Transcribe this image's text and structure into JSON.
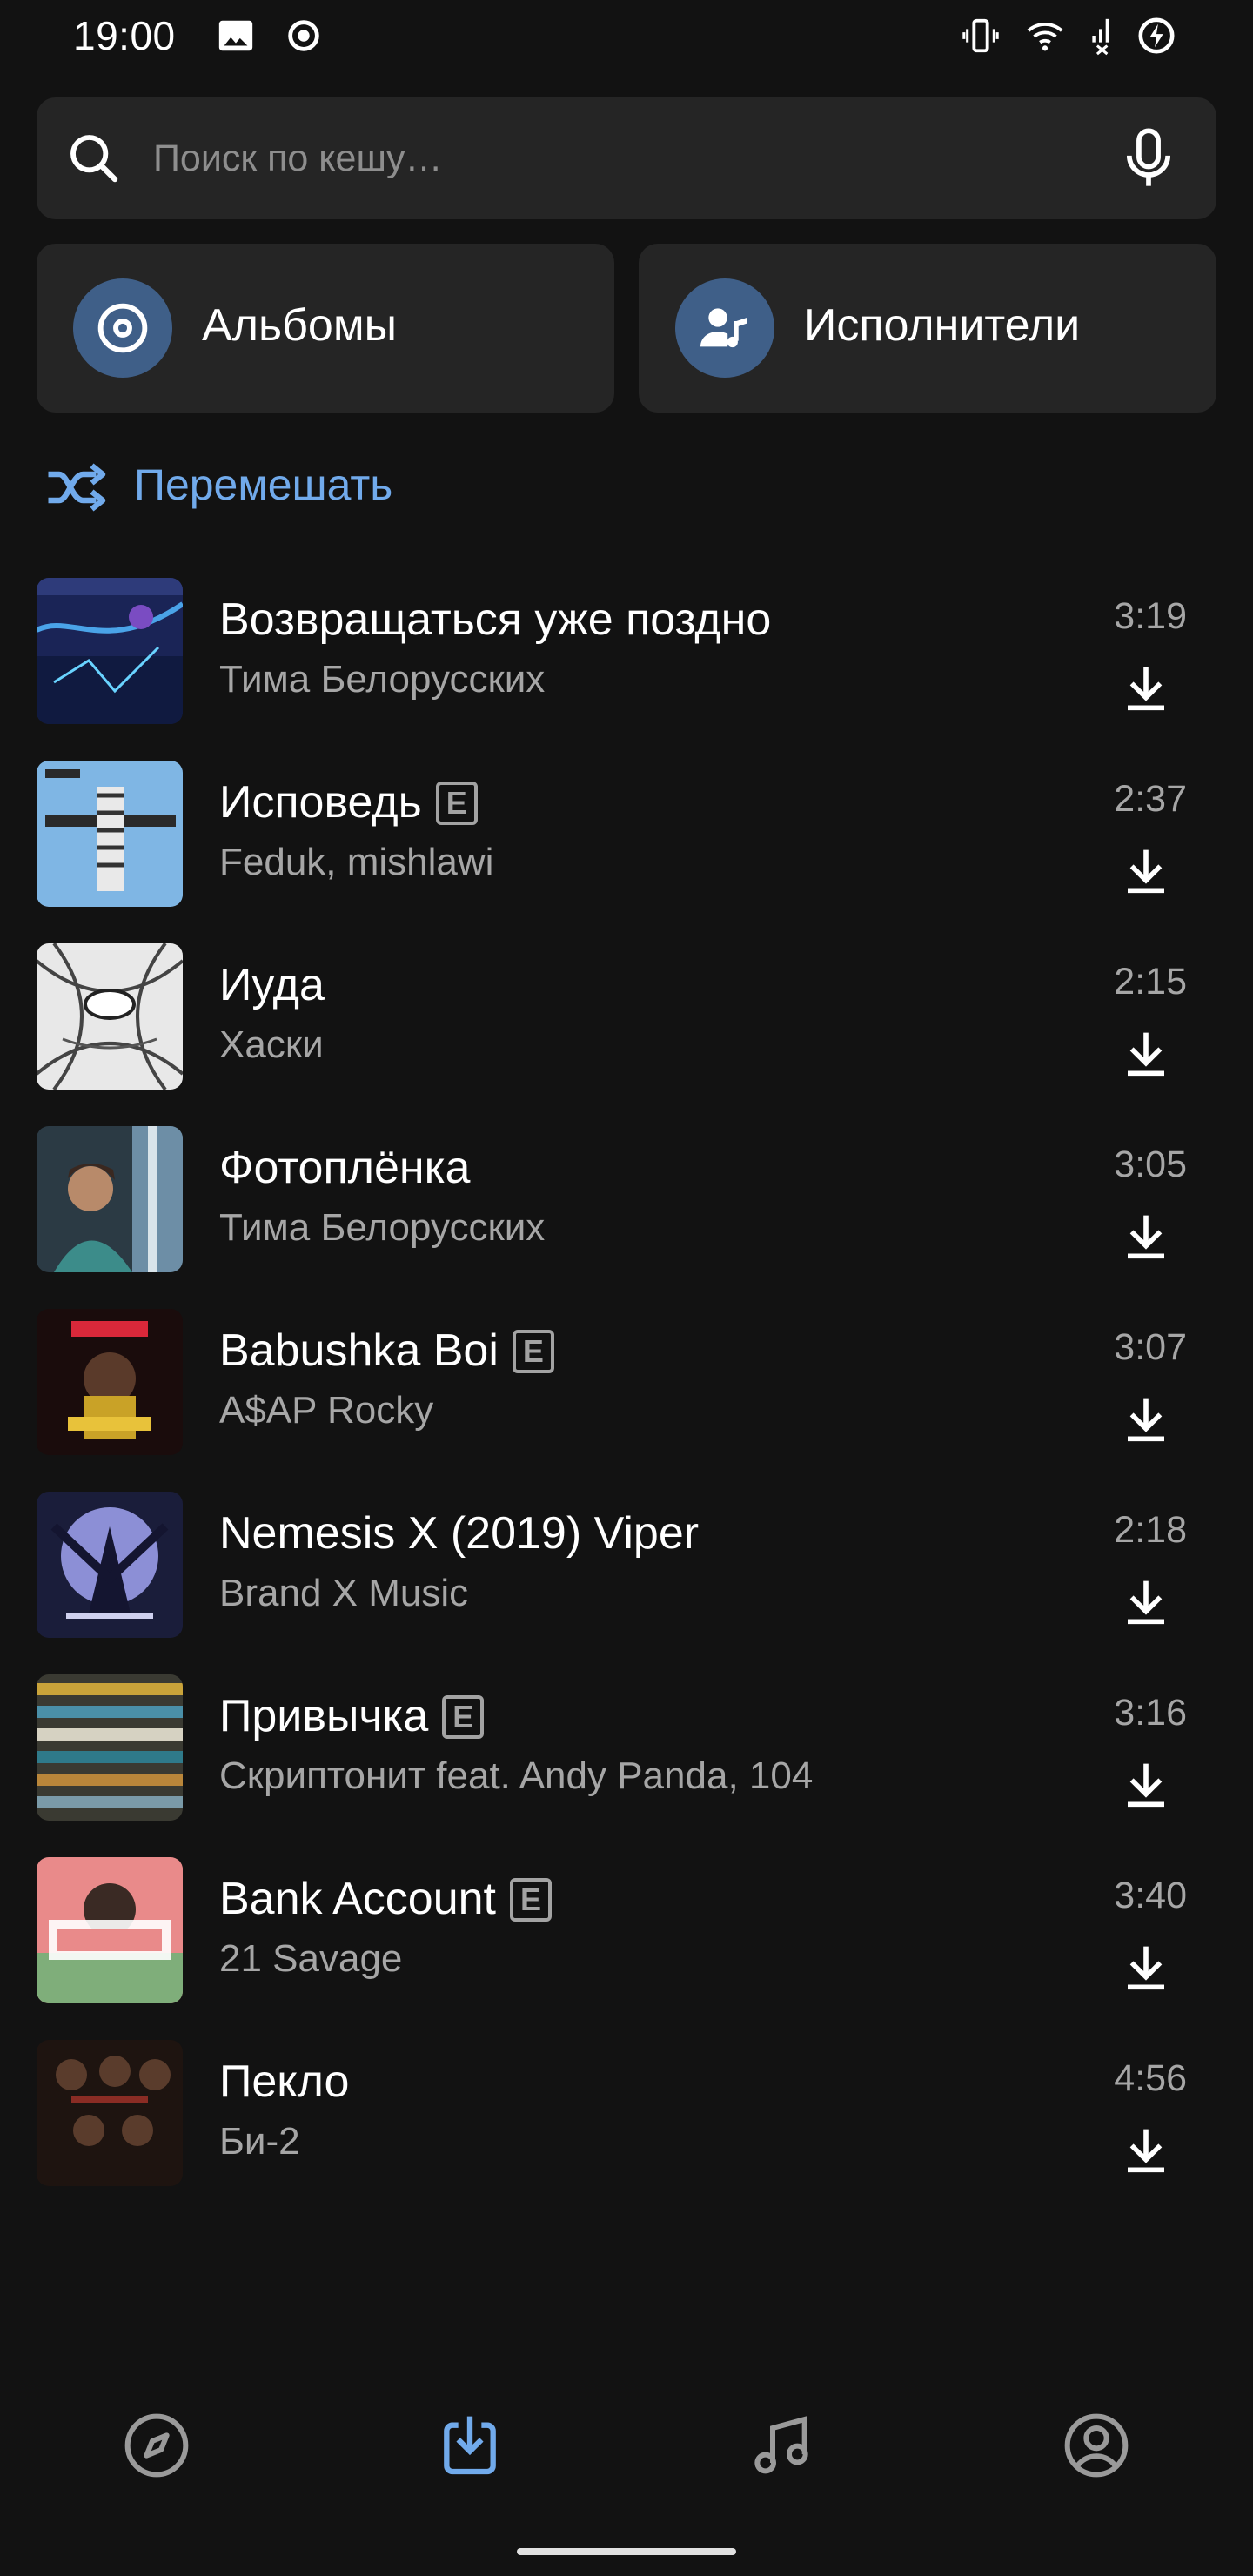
{
  "status_bar": {
    "time": "19:00",
    "icons": [
      "image-icon",
      "record-icon",
      "vibrate-icon",
      "wifi-icon",
      "signal-icon",
      "battery-charging-icon"
    ]
  },
  "search": {
    "placeholder": "Поиск по кешу…",
    "value": ""
  },
  "categories": {
    "albums_label": "Альбомы",
    "artists_label": "Исполнители"
  },
  "shuffle": {
    "label": "Перемешать"
  },
  "tracks": [
    {
      "title": "Возвращаться уже поздно",
      "artist": "Тима Белорусских",
      "duration": "3:19",
      "explicit": false,
      "explicit_mark": ""
    },
    {
      "title": "Исповедь",
      "artist": "Feduk, mishlawi",
      "duration": "2:37",
      "explicit": true,
      "explicit_mark": "E"
    },
    {
      "title": "Иуда",
      "artist": "Хаски",
      "duration": "2:15",
      "explicit": false,
      "explicit_mark": ""
    },
    {
      "title": "Фотоплёнка",
      "artist": "Тима Белорусских",
      "duration": "3:05",
      "explicit": false,
      "explicit_mark": ""
    },
    {
      "title": "Babushka Boi",
      "artist": "A$AP Rocky",
      "duration": "3:07",
      "explicit": true,
      "explicit_mark": "E"
    },
    {
      "title": "Nemesis X (2019) Viper",
      "artist": "Brand X Music",
      "duration": "2:18",
      "explicit": false,
      "explicit_mark": ""
    },
    {
      "title": "Привычка",
      "artist": "Скриптонит feat. Andy Panda, 104",
      "duration": "3:16",
      "explicit": true,
      "explicit_mark": "E"
    },
    {
      "title": "Bank Account",
      "artist": "21 Savage",
      "duration": "3:40",
      "explicit": true,
      "explicit_mark": "E"
    },
    {
      "title": "Пекло",
      "artist": "Би-2",
      "duration": "4:56",
      "explicit": false,
      "explicit_mark": ""
    }
  ],
  "bottom_nav": {
    "items": [
      "compass-icon",
      "downloads-icon",
      "music-note-icon",
      "profile-icon"
    ],
    "active": "downloads-icon"
  },
  "colors": {
    "background": "#121212",
    "card": "#252525",
    "accent": "#71aaeb",
    "icon_circle": "#3f5f88",
    "secondary_text": "#a6a6a6"
  }
}
